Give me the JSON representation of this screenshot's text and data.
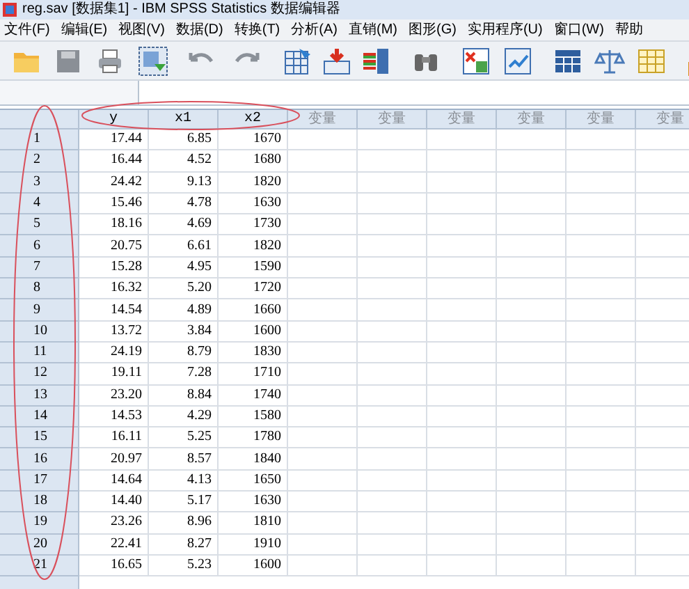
{
  "window": {
    "title": "reg.sav [数据集1] - IBM SPSS Statistics 数据编辑器"
  },
  "menu": [
    "文件(F)",
    "编辑(E)",
    "视图(V)",
    "数据(D)",
    "转换(T)",
    "分析(A)",
    "直销(M)",
    "图形(G)",
    "实用程序(U)",
    "窗口(W)",
    "帮助"
  ],
  "table": {
    "columns": [
      "y",
      "x1",
      "x2",
      "变量",
      "变量",
      "变量",
      "变量",
      "变量",
      "变量"
    ],
    "rows": [
      {
        "label": "1",
        "cells": [
          "17.44",
          "6.85",
          "1670"
        ]
      },
      {
        "label": "2",
        "cells": [
          "16.44",
          "4.52",
          "1680"
        ]
      },
      {
        "label": "3",
        "cells": [
          "24.42",
          "9.13",
          "1820"
        ]
      },
      {
        "label": "4",
        "cells": [
          "15.46",
          "4.78",
          "1630"
        ]
      },
      {
        "label": "5",
        "cells": [
          "18.16",
          "4.69",
          "1730"
        ]
      },
      {
        "label": "6",
        "cells": [
          "20.75",
          "6.61",
          "1820"
        ]
      },
      {
        "label": "7",
        "cells": [
          "15.28",
          "4.95",
          "1590"
        ]
      },
      {
        "label": "8",
        "cells": [
          "16.32",
          "5.20",
          "1720"
        ]
      },
      {
        "label": "9",
        "cells": [
          "14.54",
          "4.89",
          "1660"
        ]
      },
      {
        "label": "10",
        "cells": [
          "13.72",
          "3.84",
          "1600"
        ]
      },
      {
        "label": "11",
        "cells": [
          "24.19",
          "8.79",
          "1830"
        ]
      },
      {
        "label": "12",
        "cells": [
          "19.11",
          "7.28",
          "1710"
        ]
      },
      {
        "label": "13",
        "cells": [
          "23.20",
          "8.84",
          "1740"
        ]
      },
      {
        "label": "14",
        "cells": [
          "14.53",
          "4.29",
          "1580"
        ]
      },
      {
        "label": "15",
        "cells": [
          "16.11",
          "5.25",
          "1780"
        ]
      },
      {
        "label": "16",
        "cells": [
          "20.97",
          "8.57",
          "1840"
        ]
      },
      {
        "label": "17",
        "cells": [
          "14.64",
          "4.13",
          "1650"
        ]
      },
      {
        "label": "18",
        "cells": [
          "14.40",
          "5.17",
          "1630"
        ]
      },
      {
        "label": "19",
        "cells": [
          "23.26",
          "8.96",
          "1810"
        ]
      },
      {
        "label": "20",
        "cells": [
          "22.41",
          "8.27",
          "1910"
        ]
      },
      {
        "label": "21",
        "cells": [
          "16.65",
          "5.23",
          "1600"
        ]
      }
    ]
  }
}
